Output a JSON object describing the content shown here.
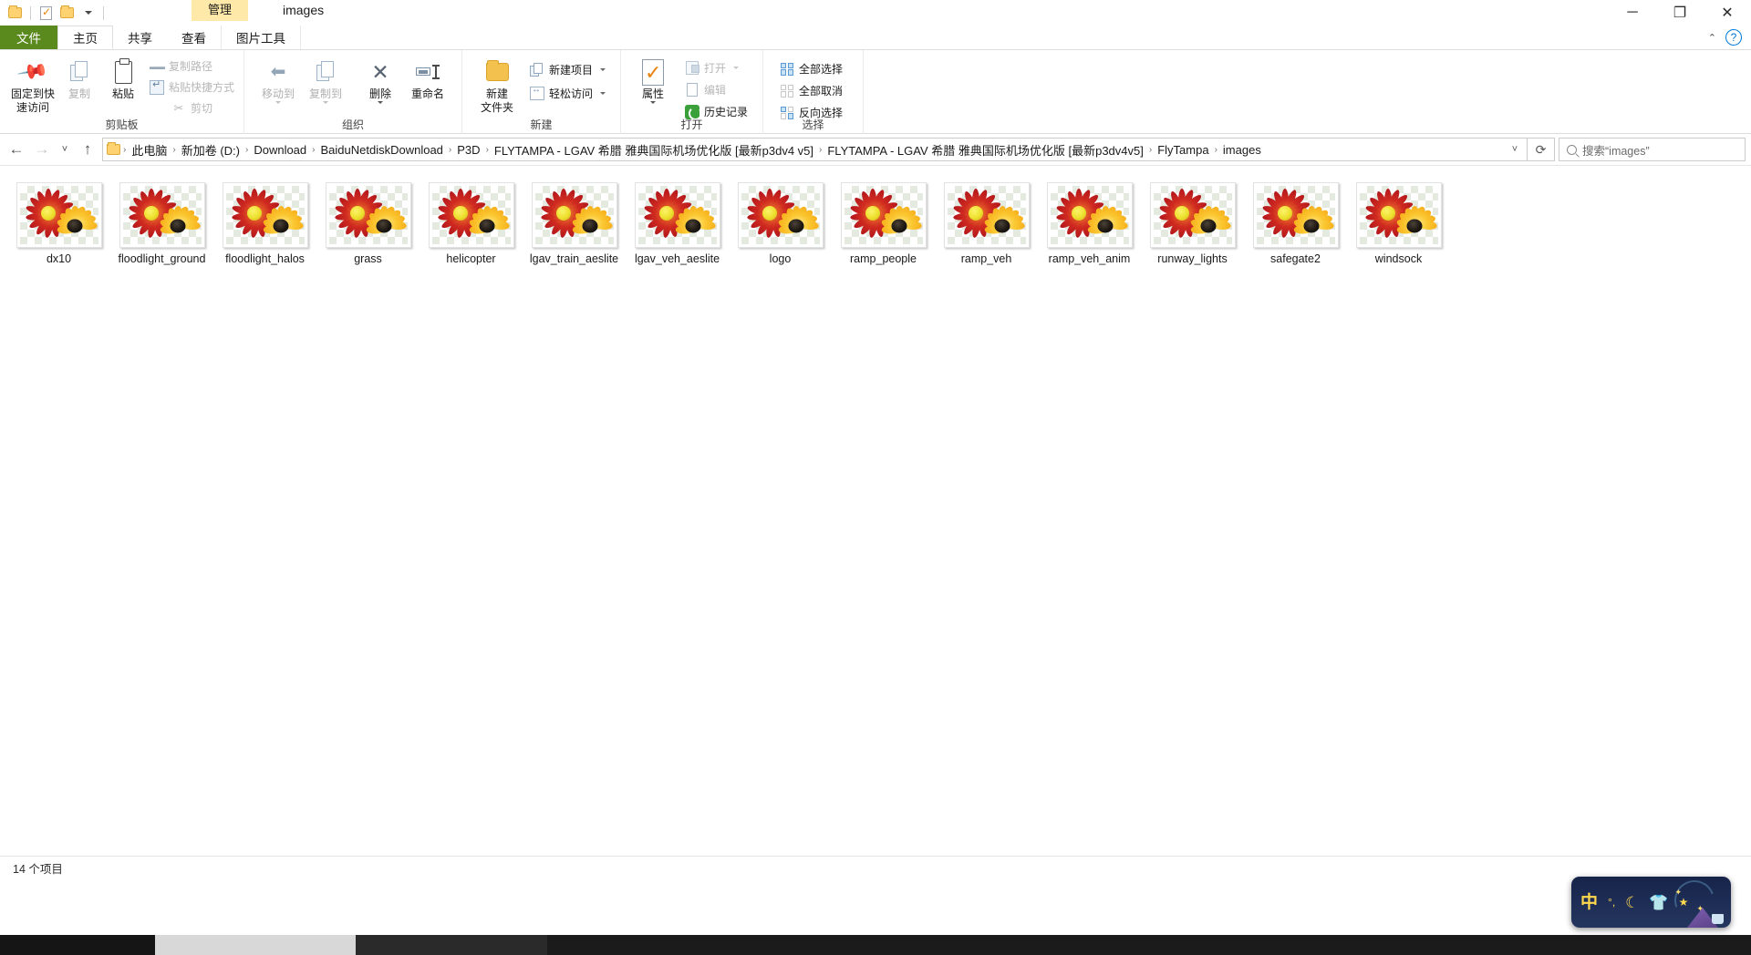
{
  "window": {
    "title": "images",
    "contextual_tab_group": "管理",
    "quick_access": [
      {
        "name": "folder-icon",
        "label": "文件资源管理器"
      },
      {
        "name": "properties-icon",
        "label": "属性"
      },
      {
        "name": "new-folder-icon",
        "label": "新建文件夹"
      },
      {
        "name": "customize-caret",
        "label": "自定义快速访问工具栏"
      }
    ],
    "controls": {
      "minimize": "─",
      "maximize": "❐",
      "close": "✕"
    }
  },
  "tabs": [
    {
      "id": "file",
      "label": "文件"
    },
    {
      "id": "home",
      "label": "主页",
      "active": true
    },
    {
      "id": "share",
      "label": "共享"
    },
    {
      "id": "view",
      "label": "查看"
    },
    {
      "id": "picture_tools",
      "label": "图片工具"
    }
  ],
  "tabstrip_right": {
    "collapse": "⌃",
    "help": "?"
  },
  "ribbon": {
    "groups": [
      {
        "id": "clipboard",
        "label": "剪贴板",
        "big": [
          {
            "name": "pin-to-quick-access",
            "label": "固定到快\n速访问",
            "line1": "固定到快",
            "line2": "速访问",
            "icon": "pin-icon"
          },
          {
            "name": "copy-button",
            "label": "复制",
            "icon": "copy-icon",
            "disabled": true
          },
          {
            "name": "paste-button",
            "label": "粘贴",
            "icon": "clipboard-icon"
          }
        ],
        "small": [
          {
            "name": "copy-path-button",
            "label": "复制路径",
            "icon": "copy-path-icon",
            "disabled": true
          },
          {
            "name": "paste-shortcut-button",
            "label": "粘贴快捷方式",
            "icon": "paste-shortcut-icon",
            "disabled": true
          },
          {
            "name": "cut-button",
            "label": "剪切",
            "icon": "scissors-icon",
            "disabled": true
          }
        ]
      },
      {
        "id": "organize",
        "label": "组织",
        "big": [
          {
            "name": "move-to-button",
            "label": "移动到",
            "icon": "arrow-left-icon",
            "disabled": true,
            "has_dropdown": true
          },
          {
            "name": "copy-to-button",
            "label": "复制到",
            "icon": "copy-to-icon",
            "disabled": true,
            "has_dropdown": true
          },
          {
            "name": "delete-button",
            "label": "删除",
            "icon": "delete-x-icon",
            "has_dropdown": true
          },
          {
            "name": "rename-button",
            "label": "重命名",
            "icon": "rename-icon"
          }
        ],
        "small": []
      },
      {
        "id": "new",
        "label": "新建",
        "big": [
          {
            "name": "new-folder-button",
            "label": "新建\n文件夹",
            "line1": "新建",
            "line2": "文件夹",
            "icon": "folder-icon"
          }
        ],
        "small": [
          {
            "name": "new-item-button",
            "label": "新建项目",
            "icon": "new-item-icon",
            "has_dropdown": true
          },
          {
            "name": "easy-access-button",
            "label": "轻松访问",
            "icon": "easy-access-icon",
            "has_dropdown": true
          }
        ]
      },
      {
        "id": "open",
        "label": "打开",
        "big": [
          {
            "name": "properties-button",
            "label": "属性",
            "icon": "properties-icon",
            "has_dropdown": true
          }
        ],
        "small": [
          {
            "name": "open-button",
            "label": "打开",
            "icon": "open-icon",
            "disabled": true,
            "has_dropdown": true
          },
          {
            "name": "edit-button",
            "label": "编辑",
            "icon": "edit-icon",
            "disabled": true
          },
          {
            "name": "history-button",
            "label": "历史记录",
            "icon": "history-icon"
          }
        ]
      },
      {
        "id": "select",
        "label": "选择",
        "big": [],
        "small": [
          {
            "name": "select-all-button",
            "label": "全部选择",
            "icon": "select-all-icon"
          },
          {
            "name": "select-none-button",
            "label": "全部取消",
            "icon": "select-none-icon"
          },
          {
            "name": "invert-selection-button",
            "label": "反向选择",
            "icon": "invert-selection-icon"
          }
        ]
      }
    ]
  },
  "address_bar": {
    "back": "←",
    "forward": "→",
    "recent": "˅",
    "up": "↑",
    "breadcrumbs": [
      "此电脑",
      "新加卷 (D:)",
      "Download",
      "BaiduNetdiskDownload",
      "P3D",
      "FLYTAMPA - LGAV 希腊 雅典国际机场优化版 [最新p3dv4 v5]",
      "FLYTAMPA - LGAV 希腊 雅典国际机场优化版 [最新p3dv4v5]",
      "FlyTampa",
      "images"
    ],
    "separator": "›",
    "history_caret": "˅",
    "refresh": "⟳",
    "search_placeholder": "搜索“images”"
  },
  "files": [
    {
      "name": "dx10"
    },
    {
      "name": "floodlight_ground"
    },
    {
      "name": "floodlight_halos"
    },
    {
      "name": "grass"
    },
    {
      "name": "helicopter"
    },
    {
      "name": "lgav_train_aeslite"
    },
    {
      "name": "lgav_veh_aeslite"
    },
    {
      "name": "logo"
    },
    {
      "name": "ramp_people"
    },
    {
      "name": "ramp_veh"
    },
    {
      "name": "ramp_veh_anim"
    },
    {
      "name": "runway_lights"
    },
    {
      "name": "safegate2"
    },
    {
      "name": "windsock"
    }
  ],
  "status_bar": {
    "item_count": "14 个项目"
  },
  "ime_bar": {
    "mode": "中",
    "punctuation": "°,",
    "moon": "☾",
    "skin": "ὅ5",
    "star": "★"
  },
  "colors": {
    "file_tab_green": "#5a8a1e",
    "contextual_yellow": "#ffe9a8",
    "accent_blue": "#0078d7",
    "close_red": "#e81123",
    "ime_navy": "#1d2c54",
    "ime_yellow": "#ffd84d"
  }
}
